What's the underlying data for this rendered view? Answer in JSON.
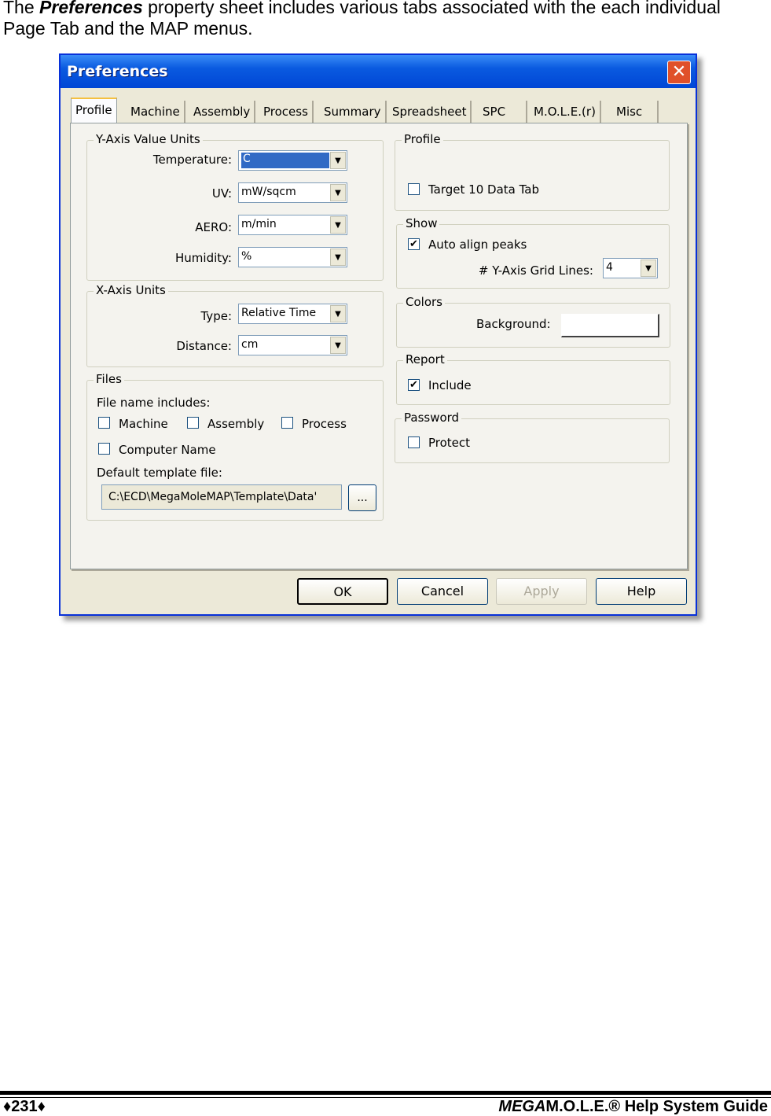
{
  "intro": {
    "prefix": "The ",
    "emph": "Preferences",
    "rest": " property sheet includes various tabs associated with the each individual Page Tab and the MAP menus."
  },
  "dialog": {
    "title": "Preferences",
    "close_icon": "close-icon",
    "tabs": [
      "Profile",
      "Machine",
      "Assembly",
      "Process",
      "Summary",
      "Spreadsheet",
      "SPC",
      "M.O.L.E.(r)",
      "Misc"
    ],
    "active_tab": "Profile",
    "y_axis": {
      "label": "Y-Axis Value Units",
      "fields": [
        {
          "label": "Temperature:",
          "value": "C"
        },
        {
          "label": "UV:",
          "value": "mW/sqcm"
        },
        {
          "label": "AERO:",
          "value": "m/min"
        },
        {
          "label": "Humidity:",
          "value": "%"
        }
      ]
    },
    "x_axis": {
      "label": "X-Axis Units",
      "fields": [
        {
          "label": "Type:",
          "value": "Relative Time"
        },
        {
          "label": "Distance:",
          "value": "cm"
        }
      ]
    },
    "files": {
      "label": "Files",
      "includes_label": "File name includes:",
      "checks": [
        {
          "label": "Machine",
          "checked": false
        },
        {
          "label": "Assembly",
          "checked": false
        },
        {
          "label": "Process",
          "checked": false
        },
        {
          "label": "Computer Name",
          "checked": false
        }
      ],
      "template_label": "Default template file:",
      "template_value": "C:\\ECD\\MegaMoleMAP\\Template\\Data'",
      "browse": "..."
    },
    "profile": {
      "label": "Profile",
      "check": {
        "label": "Target 10 Data Tab",
        "checked": false
      }
    },
    "show": {
      "label": "Show",
      "check": {
        "label": "Auto align peaks",
        "checked": true
      },
      "grid_label": "# Y-Axis Grid Lines:",
      "grid_value": "4"
    },
    "colors": {
      "label": "Colors",
      "bg_label": "Background:",
      "bg_color": "#ffffff"
    },
    "report": {
      "label": "Report",
      "check": {
        "label": "Include",
        "checked": true
      }
    },
    "password": {
      "label": "Password",
      "check": {
        "label": "Protect",
        "checked": false
      }
    },
    "buttons": {
      "ok": "OK",
      "cancel": "Cancel",
      "apply": "Apply",
      "help": "Help"
    }
  },
  "footer": {
    "page": "♦231♦",
    "brand_italic": "MEGA",
    "brand_rest": "M.O.L.E.® Help System Guide"
  }
}
